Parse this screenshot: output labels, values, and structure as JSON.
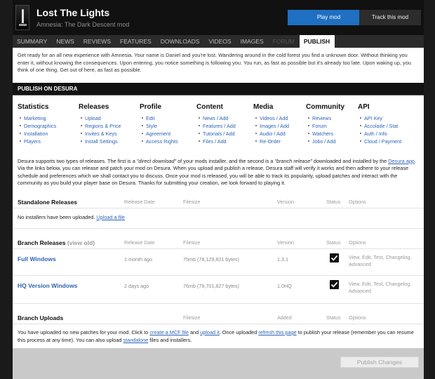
{
  "header": {
    "title": "Lost The Lights",
    "subtitle": "Amnesia: The Dark Descent mod",
    "play_button": "Play mod",
    "track_button": "Track this mod"
  },
  "tabs": [
    {
      "label": "SUMMARY"
    },
    {
      "label": "NEWS"
    },
    {
      "label": "REVIEWS"
    },
    {
      "label": "FEATURES"
    },
    {
      "label": "DOWNLOADS"
    },
    {
      "label": "VIDEOS"
    },
    {
      "label": "IMAGES"
    },
    {
      "label": "FORUM"
    },
    {
      "label": "PUBLISH"
    }
  ],
  "intro": "Get ready for an all new experience with Amnesia. Your name is Daniel and you're lost. Wandering around in the cold forest you find a unknown door. Without thinking you enter it, without knowing the consequences. Upon entering, you notice something is following you. You run, as fast as possible but it's already too late. Upon waking up, you think of one thing. Get out of here, as fast as possible.",
  "section_title": "PUBLISH ON DESURA",
  "columns": [
    {
      "title": "Statistics",
      "items": [
        "Marketing",
        "Demographics",
        "Installation",
        "Players"
      ]
    },
    {
      "title": "Releases",
      "items": [
        "Upload",
        "Regions & Price",
        "Invites & Keys",
        "Install Settings"
      ]
    },
    {
      "title": "Profile",
      "items": [
        "Edit",
        "Style",
        "Agreement",
        "Access Rights"
      ]
    },
    {
      "title": "Content",
      "items": [
        "News / Add",
        "Features / Add",
        "Tutorials / Add",
        "Files / Add"
      ]
    },
    {
      "title": "Media",
      "items": [
        "Videos / Add",
        "Images / Add",
        "Audio / Add",
        "Re-Order"
      ]
    },
    {
      "title": "Community",
      "items": [
        "Reviews",
        "Forum",
        "Watchers",
        "Jobs / Add"
      ]
    },
    {
      "title": "API",
      "items": [
        "API Key",
        "Accolade / Stat",
        "Auth / Info",
        "Cloud / Payment"
      ]
    }
  ],
  "desc": {
    "p1": "Desura supports two types of releases. The first is a ",
    "em1": "\"direct download\"",
    "p2": " of your mods installer, and the second is a ",
    "em2": "\"branch release\"",
    "p3": " downloaded and installed by the ",
    "link": "Desura app",
    "p4": ". Via the links below, you can release and patch your mod on Desura. When you upload and publish a release, Desura staff will verify it works and then adhere to your release schedule and preferences which we shall contact you to discuss. Once your mod is released, you will be able to track its popularity, upload patches and interact with the community as you build your player base on Desura. Thanks for submitting your creation, we look forward to playing it."
  },
  "standalone": {
    "title": "Standalone Releases",
    "col_date": "Release Date",
    "col_size": "Filesize",
    "col_version": "Version",
    "col_status": "Status",
    "col_options": "Options",
    "empty_text": "No installers have been uploaded.",
    "upload_link": "Upload a file"
  },
  "branch": {
    "title": "Branch Releases",
    "view_old": "(view old)",
    "col_date": "Release Date",
    "col_size": "Filesize",
    "col_version": "Version",
    "col_status": "Status",
    "col_options": "Options",
    "rows": [
      {
        "name": "Full Windows",
        "date": "1 month ago",
        "size": "75mb (78,129,821 bytes)",
        "version": "1.3.1",
        "options": "View, Edit, Test, Changelog, Advanced"
      },
      {
        "name": "HQ Version Windows",
        "date": "2 days ago",
        "size": "76mb (79,701,827 bytes)",
        "version": "1.0HQ",
        "options": "View, Edit, Test, Changelog, Advanced"
      }
    ]
  },
  "uploads": {
    "title": "Branch Uploads",
    "col_size": "Filesize",
    "col_added": "Added",
    "col_status": "Status",
    "col_options": "Options",
    "t1": "You have uploaded no new patches for your mod. Click to ",
    "l1": "create a MCF file",
    "t2": " and ",
    "l2": "upload it",
    "t3": ". Once uploaded ",
    "l3": "refresh this page",
    "t4": " to publish your release (remember you can resume this process at any time). You can also upload ",
    "l4": "standalone",
    "t5": " files and installers."
  },
  "publish_button": "Publish Changes",
  "colors": {
    "accent": "#1f6fc2",
    "link": "#2d64b5",
    "bar": "#121212"
  }
}
